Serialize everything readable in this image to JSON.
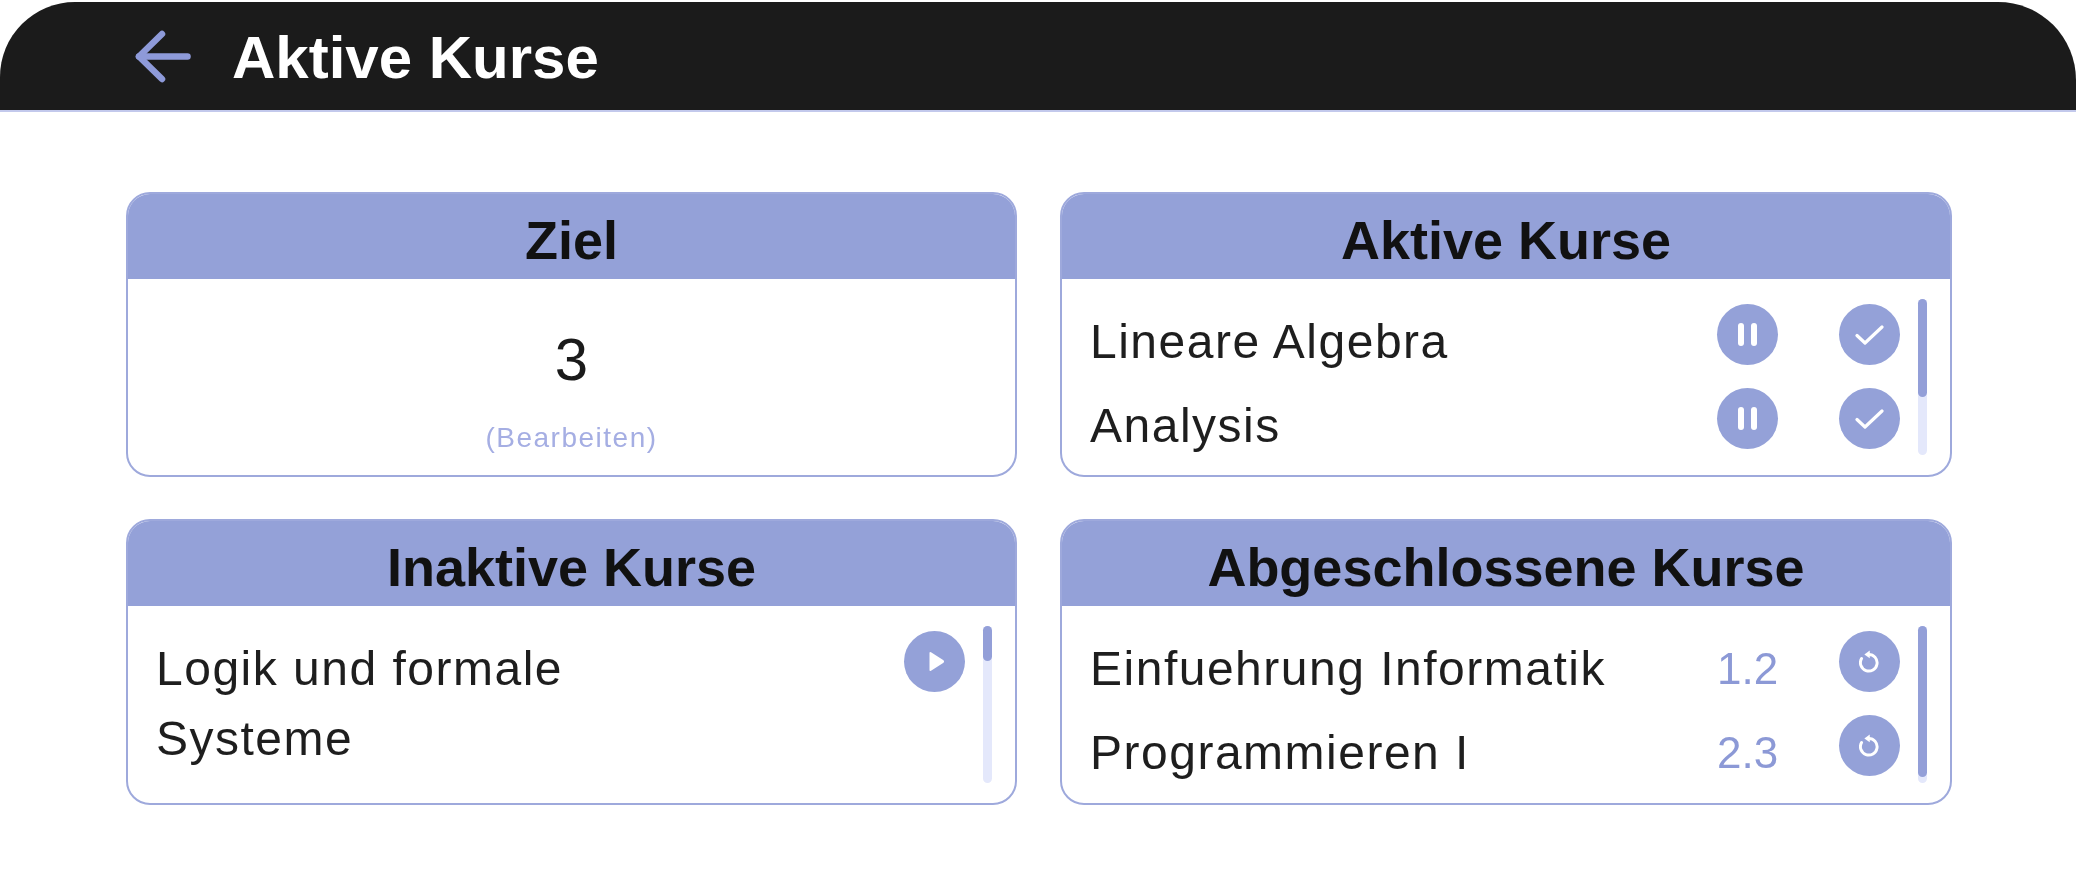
{
  "header": {
    "title": "Aktive Kurse"
  },
  "cards": [
    {
      "kind": "goal",
      "title": "Ziel",
      "value": "3",
      "edit_link": "(Bearbeiten)"
    },
    {
      "kind": "active",
      "title": "Aktive Kurse",
      "courses": [
        {
          "name": "Lineare Algebra"
        },
        {
          "name": "Analysis"
        }
      ]
    },
    {
      "kind": "inactive",
      "title": "Inaktive Kurse",
      "courses": [
        {
          "name": "Logik und formale Systeme"
        }
      ]
    },
    {
      "kind": "completed",
      "title": "Abgeschlossene Kurse",
      "courses": [
        {
          "name": "Einfuehrung Informatik",
          "grade": "1.2"
        },
        {
          "name": "Programmieren I",
          "grade": "2.3"
        }
      ]
    }
  ]
}
